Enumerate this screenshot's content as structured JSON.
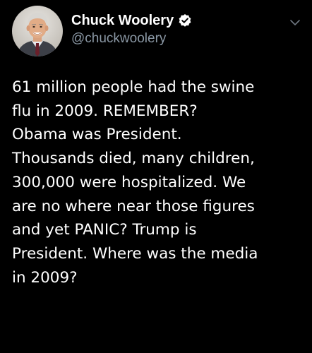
{
  "author": {
    "display_name": "Chuck Woolery",
    "handle": "@chuckwoolery",
    "verified": true
  },
  "icons": {
    "verified": "verified-badge-icon",
    "more": "chevron-down-icon"
  },
  "tweet": {
    "lines": [
      "61 million people had the swine",
      "flu in 2009. REMEMBER?",
      "Obama was President.",
      "Thousands died, many children,",
      "300,000 were hospitalized. We",
      "are no where near those figures",
      "and yet PANIC? Trump is",
      "President. Where was the media",
      "in 2009?"
    ]
  },
  "colors": {
    "background": "#000000",
    "text": "#ffffff",
    "secondary_text": "#8b98a5"
  }
}
